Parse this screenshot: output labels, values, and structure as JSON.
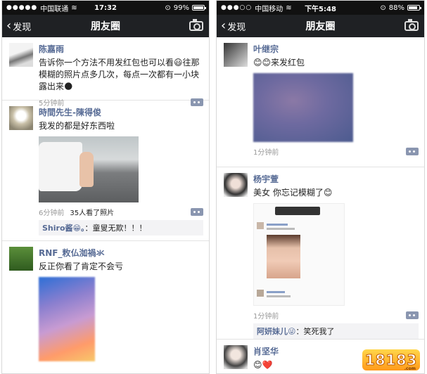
{
  "left": {
    "status": {
      "carrier": "中国联通",
      "time": "17:32",
      "battery": "99%",
      "battery_level": 0.99
    },
    "nav": {
      "back": "发现",
      "title": "朋友圈"
    },
    "posts": [
      {
        "name": "陈嘉雨",
        "text": "告诉你一个方法不用发红包也可以看😃往那模糊的照片点多几次，每点一次都有一小块露出来🌑",
        "time": "5分钟前"
      },
      {
        "name": "時間先生-陳得俊",
        "text": "我发的都是好东西啦",
        "time": "6分钟前",
        "extra": "35人看了照片",
        "comment": {
          "who": "Shiro酱😁。",
          "text": "：童叟无欺！！！"
        }
      },
      {
        "name": "RNF_敉仏洳禍氺",
        "text": "反正你看了肯定不会亏"
      }
    ]
  },
  "right": {
    "status": {
      "carrier": "中国移动",
      "time": "下午5:48",
      "battery": "88%",
      "battery_level": 0.88
    },
    "nav": {
      "back": "发现",
      "title": "朋友圈"
    },
    "posts": [
      {
        "name": "叶继宗",
        "text": "😊😊来发红包",
        "time": "1分钟前"
      },
      {
        "name": "杨宇萱",
        "text": "美女 你忘记模糊了😊",
        "time": "1分钟前",
        "comment": {
          "who": "阿妍妹儿😜",
          "text": "：笑死我了"
        }
      },
      {
        "name": "肖坚华",
        "text": "😊❤️"
      }
    ]
  },
  "watermark": {
    "text": "18183",
    "sub": ".com"
  }
}
